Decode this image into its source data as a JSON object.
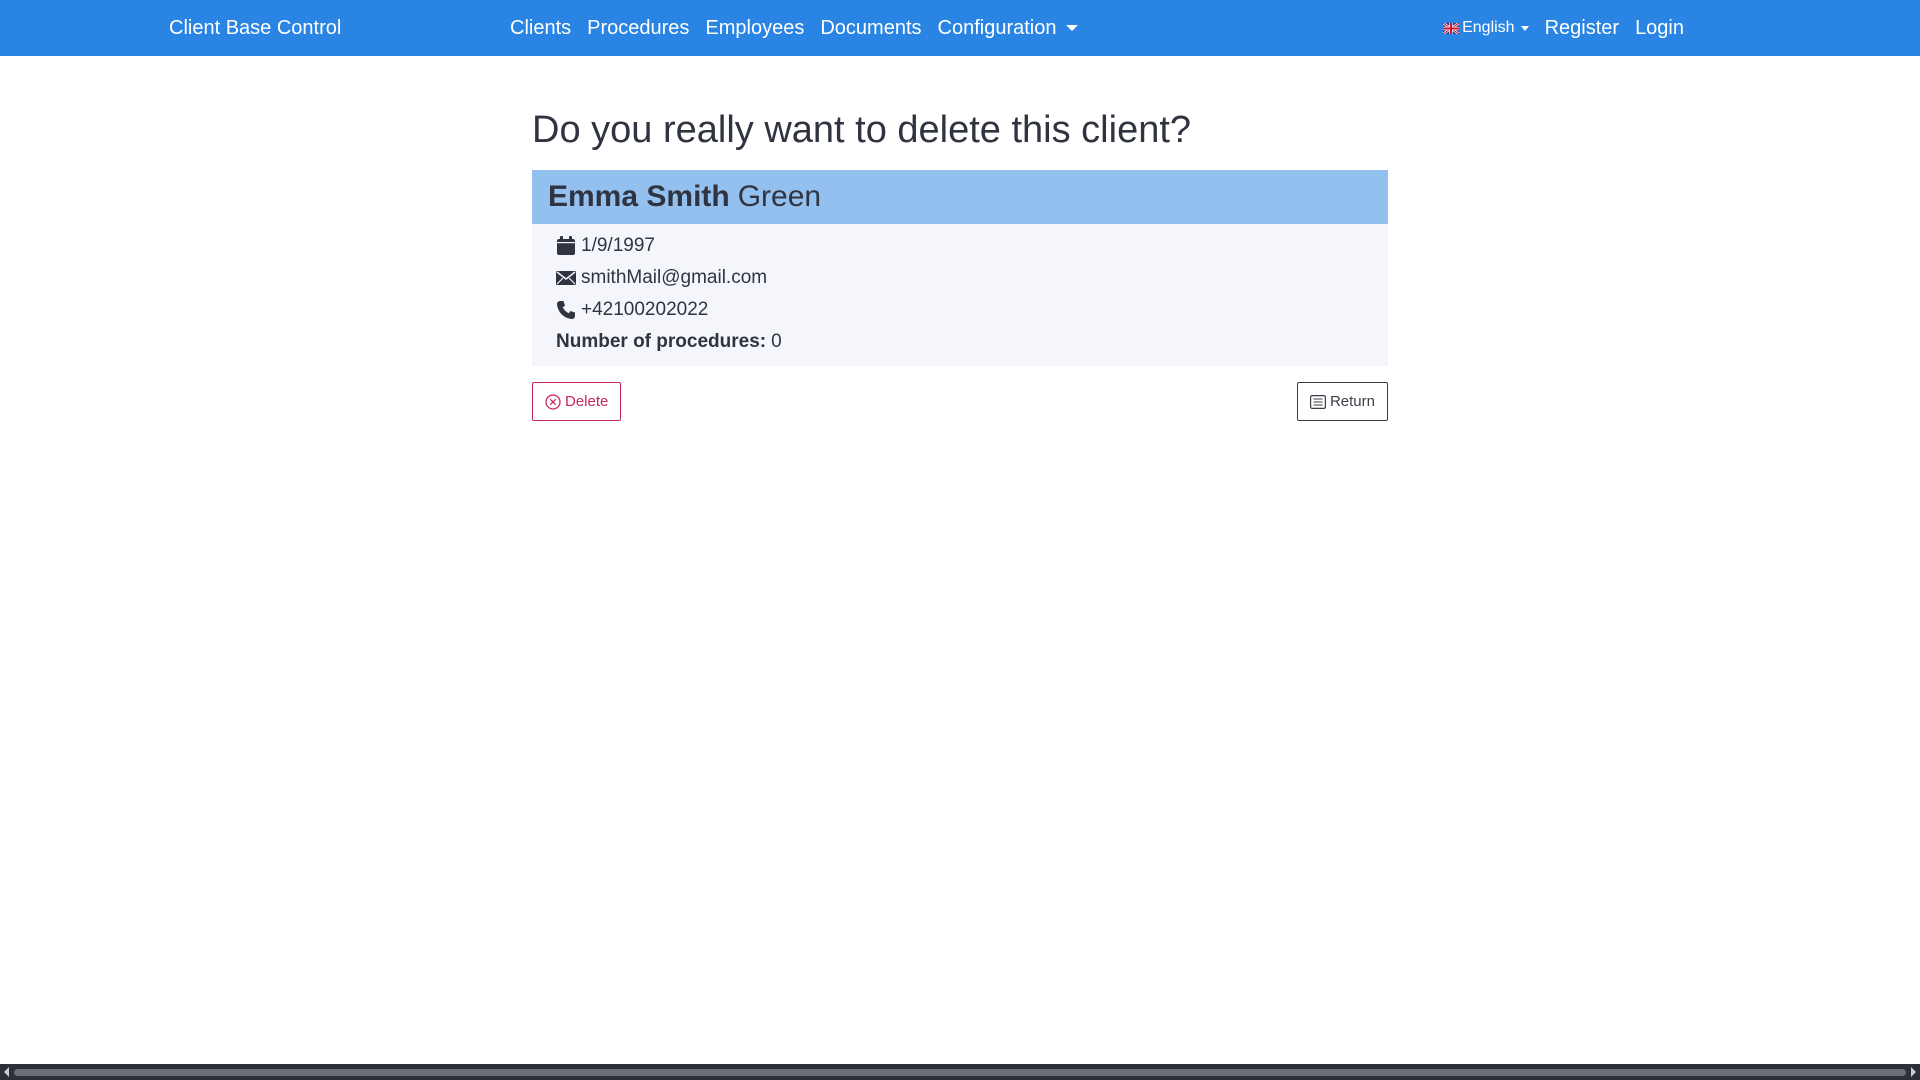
{
  "navbar": {
    "brand": "Client Base Control",
    "links": [
      {
        "label": "Clients"
      },
      {
        "label": "Procedures"
      },
      {
        "label": "Employees"
      },
      {
        "label": "Documents"
      },
      {
        "label": "Configuration"
      }
    ],
    "language": "English",
    "register": "Register",
    "login": "Login"
  },
  "page": {
    "title": "Do you really want to delete this client?"
  },
  "client": {
    "first_name": "Emma Smith",
    "last_name": "Green",
    "birth_date": "1/9/1997",
    "email": "smithMail@gmail.com",
    "phone": "+42100202022",
    "procedures_label": "Number of procedures:",
    "procedures_count": "0"
  },
  "actions": {
    "delete_label": "Delete",
    "return_label": "Return"
  },
  "colors": {
    "navbar": "#2a84e4",
    "card_header": "#94c0f0",
    "delete": "#c8285a"
  }
}
